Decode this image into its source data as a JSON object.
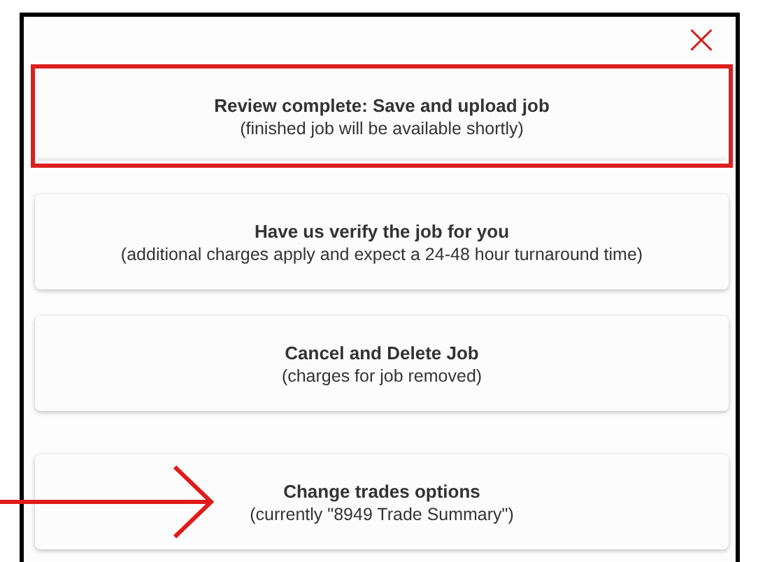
{
  "dialog": {
    "close_label": "×"
  },
  "options": [
    {
      "title": "Review complete: Save and upload job",
      "subtitle": "(finished job will be available shortly)",
      "highlighted": true
    },
    {
      "title": "Have us verify the job for you",
      "subtitle": "(additional charges apply and expect a 24-48 hour turnaround time)",
      "highlighted": false
    },
    {
      "title": "Cancel and Delete Job",
      "subtitle": "(charges for job removed)",
      "highlighted": false
    },
    {
      "title": "Change trades options",
      "subtitle": "(currently \"8949 Trade Summary\")",
      "highlighted": false,
      "pointed_at": true
    }
  ]
}
